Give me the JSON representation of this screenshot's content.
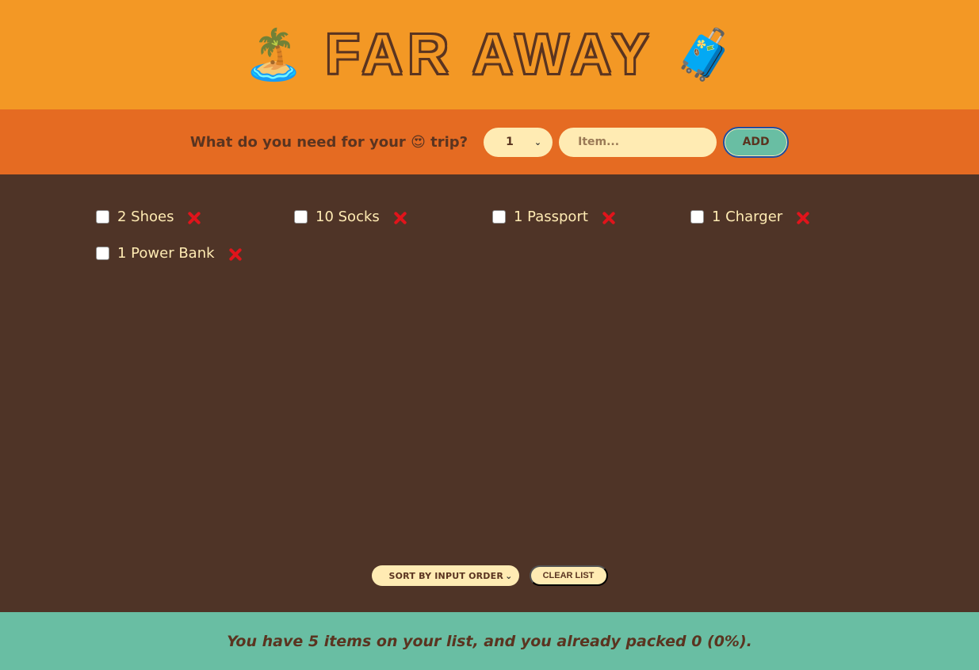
{
  "header": {
    "title": "FAR AWAY",
    "left_icon": "🏝️",
    "right_icon": "🧳"
  },
  "form": {
    "question_prefix": "What do you need for your",
    "question_emoji": "😍",
    "question_suffix": "trip?",
    "quantity_value": "1",
    "item_placeholder": "Item...",
    "add_label": "ADD"
  },
  "items": [
    {
      "label": "2 Shoes",
      "packed": false
    },
    {
      "label": "10 Socks",
      "packed": false
    },
    {
      "label": "1 Passport",
      "packed": false
    },
    {
      "label": "1 Charger",
      "packed": false
    },
    {
      "label": "1 Power Bank",
      "packed": false
    }
  ],
  "actions": {
    "sort_value": "SORT BY INPUT ORDER",
    "clear_label": "CLEAR LIST"
  },
  "stats": {
    "text": "You have 5 items on your list, and you already packed 0 (0%)."
  },
  "colors": {
    "header_bg": "#f39825",
    "form_bg": "#e56b22",
    "list_bg": "#4f3427",
    "footer_bg": "#69bea3",
    "remove_red": "#e0141b"
  }
}
